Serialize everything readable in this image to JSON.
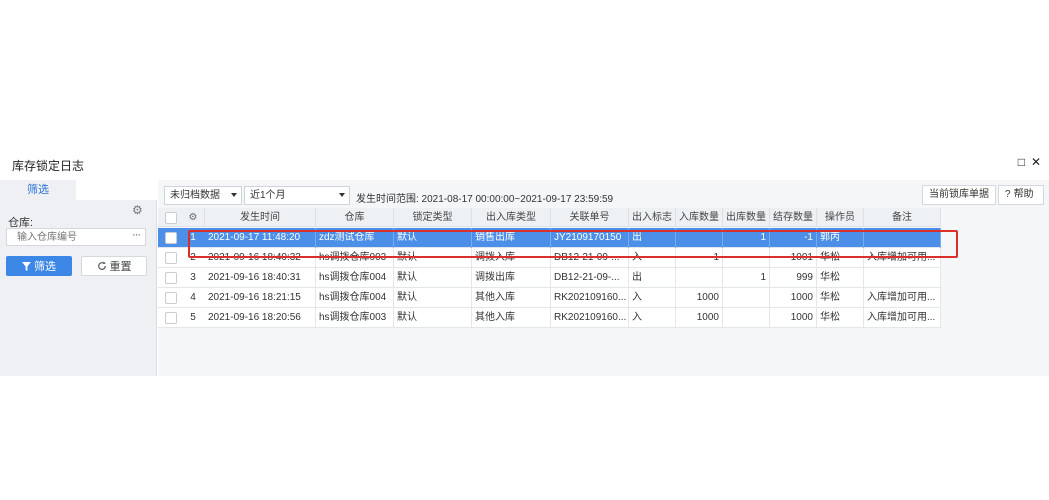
{
  "window": {
    "title": "库存锁定日志",
    "controls": {
      "maximize": "□",
      "close": "✕"
    }
  },
  "sidebar": {
    "tab_label": "筛选",
    "warehouse_label": "仓库:",
    "warehouse_placeholder": "输入仓库编号",
    "more_label": "···",
    "filter_button": "筛选",
    "reset_button": "重置"
  },
  "toolbar": {
    "archive_select": "未归档数据",
    "period_select": "近1个月",
    "range_label": "发生时间范围: 2021-08-17 00:00:00~2021-09-17 23:59:59",
    "current_lock_button": "当前锁库单据",
    "help_button": "帮助"
  },
  "table": {
    "columns": [
      "发生时间",
      "仓库",
      "锁定类型",
      "出入库类型",
      "关联单号",
      "出入标志",
      "入库数量",
      "出库数量",
      "结存数量",
      "操作员",
      "备注"
    ],
    "rows": [
      {
        "num": "1",
        "time": "2021-09-17 11:48:20",
        "warehouse": "zdz测试仓库",
        "lock_type": "默认",
        "io_type": "销售出库",
        "ref": "JY2109170150",
        "flag": "出",
        "in_qty": "",
        "out_qty": "1",
        "balance": "-1",
        "operator": "郭丙",
        "remark": ""
      },
      {
        "num": "2",
        "time": "2021-09-16 18:40:32",
        "warehouse": "hs调拨仓库003",
        "lock_type": "默认",
        "io_type": "调拨入库",
        "ref": "DB12-21-09-...",
        "flag": "入",
        "in_qty": "1",
        "out_qty": "",
        "balance": "1001",
        "operator": "华松",
        "remark": "入库增加可用..."
      },
      {
        "num": "3",
        "time": "2021-09-16 18:40:31",
        "warehouse": "hs调拨仓库004",
        "lock_type": "默认",
        "io_type": "调拨出库",
        "ref": "DB12-21-09-...",
        "flag": "出",
        "in_qty": "",
        "out_qty": "1",
        "balance": "999",
        "operator": "华松",
        "remark": ""
      },
      {
        "num": "4",
        "time": "2021-09-16 18:21:15",
        "warehouse": "hs调拨仓库004",
        "lock_type": "默认",
        "io_type": "其他入库",
        "ref": "RK202109160...",
        "flag": "入",
        "in_qty": "1000",
        "out_qty": "",
        "balance": "1000",
        "operator": "华松",
        "remark": "入库增加可用..."
      },
      {
        "num": "5",
        "time": "2021-09-16 18:20:56",
        "warehouse": "hs调拨仓库003",
        "lock_type": "默认",
        "io_type": "其他入库",
        "ref": "RK202109160...",
        "flag": "入",
        "in_qty": "1000",
        "out_qty": "",
        "balance": "1000",
        "operator": "华松",
        "remark": "入库增加可用..."
      }
    ]
  },
  "colors": {
    "accent": "#3c86e6",
    "selected_row": "#4c8fe8",
    "highlight_border": "#d9302c"
  }
}
